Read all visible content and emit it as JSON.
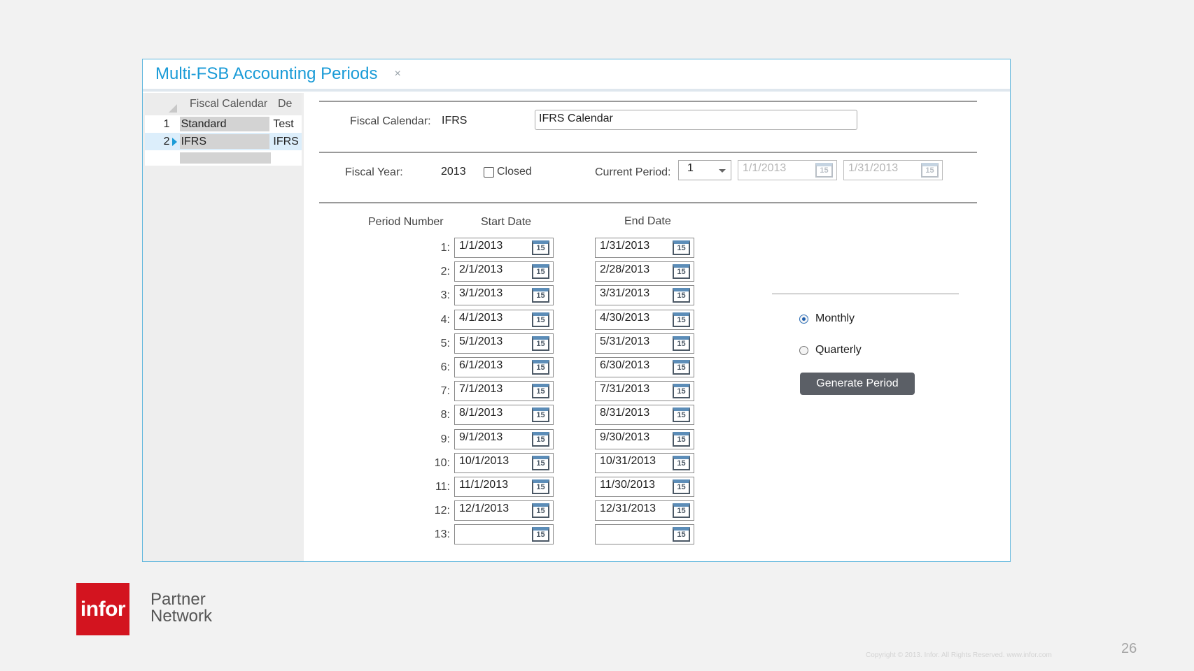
{
  "window": {
    "tab_title": "Multi-FSB Accounting Periods",
    "tab_close": "×"
  },
  "grid": {
    "headers": [
      "Fiscal Calendar",
      "De"
    ],
    "rows": [
      {
        "num": "1",
        "name": "Standard",
        "desc": "Test"
      },
      {
        "num": "2",
        "name": "IFRS",
        "desc": "IFRS"
      }
    ]
  },
  "form": {
    "fiscal_calendar_label": "Fiscal Calendar:",
    "fiscal_calendar_value": "IFRS",
    "fiscal_calendar_desc": "IFRS Calendar",
    "fiscal_year_label": "Fiscal Year:",
    "fiscal_year_value": "2013",
    "closed_label": "Closed",
    "current_period_label": "Current Period:",
    "current_period_value": "1",
    "current_start": "1/1/2013",
    "current_end": "1/31/2013"
  },
  "periods": {
    "col_period_number": "Period Number",
    "col_start_date": "Start Date",
    "col_end_date": "End Date",
    "calendar_icon_text": "15",
    "rows": [
      {
        "num": "1:",
        "start": "1/1/2013",
        "end": "1/31/2013"
      },
      {
        "num": "2:",
        "start": "2/1/2013",
        "end": "2/28/2013"
      },
      {
        "num": "3:",
        "start": "3/1/2013",
        "end": "3/31/2013"
      },
      {
        "num": "4:",
        "start": "4/1/2013",
        "end": "4/30/2013"
      },
      {
        "num": "5:",
        "start": "5/1/2013",
        "end": "5/31/2013"
      },
      {
        "num": "6:",
        "start": "6/1/2013",
        "end": "6/30/2013"
      },
      {
        "num": "7:",
        "start": "7/1/2013",
        "end": "7/31/2013"
      },
      {
        "num": "8:",
        "start": "8/1/2013",
        "end": "8/31/2013"
      },
      {
        "num": "9:",
        "start": "9/1/2013",
        "end": "9/30/2013"
      },
      {
        "num": "10:",
        "start": "10/1/2013",
        "end": "10/31/2013"
      },
      {
        "num": "11:",
        "start": "11/1/2013",
        "end": "11/30/2013"
      },
      {
        "num": "12:",
        "start": "12/1/2013",
        "end": "12/31/2013"
      },
      {
        "num": "13:",
        "start": "",
        "end": ""
      }
    ]
  },
  "options": {
    "monthly_label": "Monthly",
    "quarterly_label": "Quarterly",
    "selected": "Monthly",
    "generate_button": "Generate Period"
  },
  "footer": {
    "logo_text": "infor",
    "partner_line1": "Partner",
    "partner_line2": "Network",
    "copyright": "Copyright © 2013. Infor. All Rights Reserved. www.infor.com",
    "page_number": "26"
  },
  "colors": {
    "accent": "#1a9bd7",
    "logo_red": "#d3141f",
    "button": "#5b5f66"
  }
}
